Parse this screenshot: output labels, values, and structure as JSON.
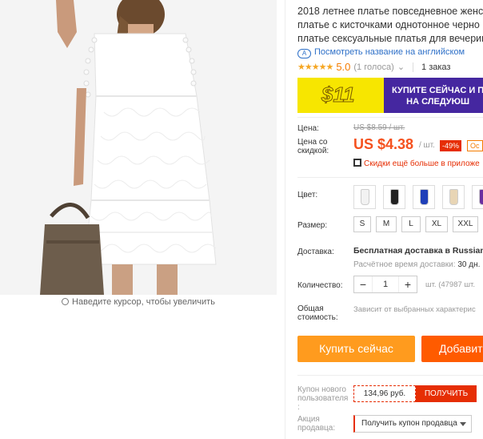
{
  "product": {
    "title_lines": [
      "2018 летнее платье повседневное женск",
      "платье с кисточками однотонное черно",
      "платье сексуальные платья для вечерин"
    ],
    "translate_link": "Посмотреть название на английском",
    "translate_icon": "translate-icon",
    "rating": {
      "stars": "★★★★★",
      "score": "5.0",
      "votes": "(1 голоса)",
      "orders": "1 заказ"
    },
    "zoom_hint": "Наведите курсор, чтобы увеличить"
  },
  "banner": {
    "amount": "$11",
    "text_line1": "КУПИТЕ СЕЙЧАС И П",
    "text_line2": "НА СЛЕДУЮШ",
    "colors": {
      "background": "#4527a0",
      "accent": "#f7e600"
    }
  },
  "pricing": {
    "price_label": "Цена:",
    "old_price": "US $8.59 / шт.",
    "discount_price_label": "Цена со скидкой:",
    "price": "US $4.38",
    "per_unit": "/ шт.",
    "discount_badge": "-49%",
    "extra_badge": "Ос",
    "app_deal": "Скидки ещё больше в приложе"
  },
  "options": {
    "color_label": "Цвет:",
    "swatches": [
      {
        "name": "white",
        "color": "#f2f2f2"
      },
      {
        "name": "black",
        "color": "#222222"
      },
      {
        "name": "blue",
        "color": "#1f3fb8"
      },
      {
        "name": "beige",
        "color": "#e8d5b5"
      },
      {
        "name": "purple",
        "color": "#6a2fa0"
      }
    ],
    "size_label": "Размер:",
    "sizes": [
      "S",
      "M",
      "L",
      "XL",
      "XXL"
    ],
    "shipping_label": "Доставка:",
    "shipping_title": "Бесплатная доставка в Russian F",
    "shipping_time_label": "Расчётное время доставки:",
    "shipping_time_value": "30 дн.",
    "quantity_label": "Количество:",
    "quantity": "1",
    "quantity_note": "шт. (47987 шт.",
    "total_label": "Общая стоимость:",
    "total_value": "Зависит от выбранных характерис"
  },
  "actions": {
    "buy_now": "Купить сейчас",
    "add_to_cart": "Добавит"
  },
  "coupons": {
    "new_user_label": "Купон нового пользователя :",
    "new_user_value": "134,96 руб.",
    "get_button": "ПОЛУЧИТЬ",
    "seller_label": "Акция продавца:",
    "seller_select": "Получить купон продавца"
  }
}
